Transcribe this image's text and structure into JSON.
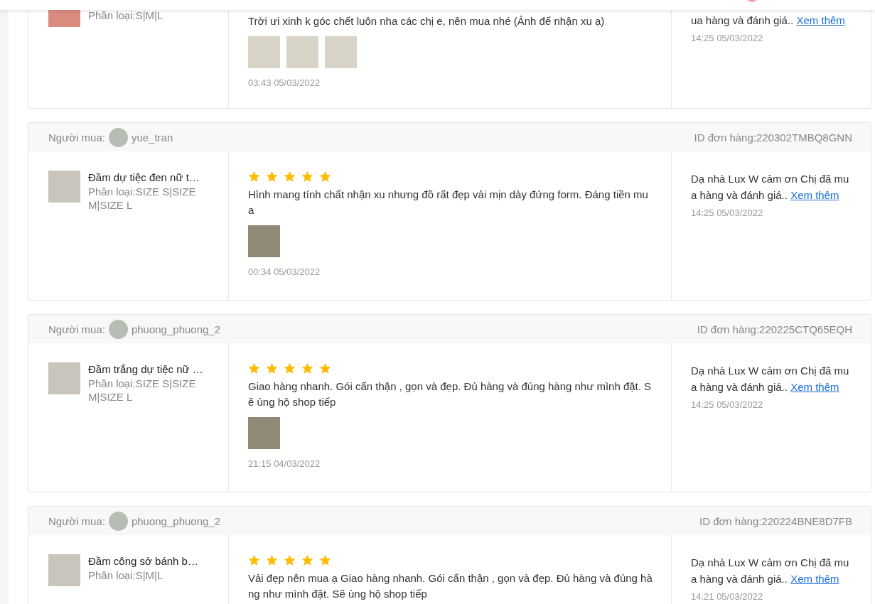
{
  "top_bar": {
    "has_badge": true
  },
  "reviews": [
    {
      "cut_off_top": true,
      "product": {
        "variation": "Phân loại:S|M|L"
      },
      "text": "Trời ưi xinh k góc chết luôn nha các chị e, nên mua nhé (Ảnh để nhận xu ạ)",
      "photos": [
        {
          "kind": "image"
        },
        {
          "kind": "image"
        },
        {
          "kind": "image"
        }
      ],
      "time": "03:43 05/03/2022",
      "reply": {
        "text": "ua hàng và đánh giá..",
        "link": "Xem thêm",
        "time": "14:25 05/03/2022"
      }
    },
    {
      "cut_off_top": false,
      "buyer": {
        "label": "Người mua:",
        "name": "yue_tran"
      },
      "order_id": "ID đơn hàng:220302TMBQ8GNN",
      "product": {
        "name": "Đầm dự tiệc đen nữ t…",
        "variation": "Phân loại:SIZE S|SIZE M|SIZE L"
      },
      "stars": 5,
      "text": "Hình mang tính chất nhận xu nhưng đồ rất đẹp vải mịn dày đứng form. Đáng tiền mua",
      "photos": [
        {
          "kind": "image"
        }
      ],
      "time": "00:34 05/03/2022",
      "reply": {
        "text": "Dạ nhà Lux W cảm ơn Chị đã mua hàng và đánh giá..",
        "link": "Xem thêm",
        "time": "14:25 05/03/2022"
      }
    },
    {
      "cut_off_top": false,
      "buyer": {
        "label": "Người mua:",
        "name": "phuong_phuong_2"
      },
      "order_id": "ID đơn hàng:220225CTQ65EQH",
      "product": {
        "name": "Đầm trắng dự tiệc nữ …",
        "variation": "Phân loại:SIZE S|SIZE M|SIZE L"
      },
      "stars": 5,
      "text": "Giao hàng nhanh. Gói cẩn thận , gọn và đẹp. Đủ hàng và đúng hàng như mình đặt. Sẽ ủng hộ shop tiếp",
      "photos": [
        {
          "kind": "image"
        }
      ],
      "time": "21:15 04/03/2022",
      "reply": {
        "text": "Dạ nhà Lux W cảm ơn Chị đã mua hàng và đánh giá..",
        "link": "Xem thêm",
        "time": "14:25 05/03/2022"
      }
    },
    {
      "cut_off_top": false,
      "buyer": {
        "label": "Người mua:",
        "name": "phuong_phuong_2"
      },
      "order_id": "ID đơn hàng:220224BNE8D7FB",
      "product": {
        "name": "Đầm công sở bánh b…",
        "variation": "Phân loại:S|M|L"
      },
      "stars": 5,
      "text": "Vải đẹp nên mua ạ Giao hàng nhanh. Gói cẩn thận , gọn và đẹp. Đủ hàng và đúng hàng như mình đặt. Sẽ ủng hộ shop tiếp",
      "reply": {
        "text": "Dạ nhà Lux W cảm ơn Chị đã mua hàng và đánh giá..",
        "link": "Xem thêm",
        "time": "14:21 05/03/2022"
      }
    }
  ]
}
